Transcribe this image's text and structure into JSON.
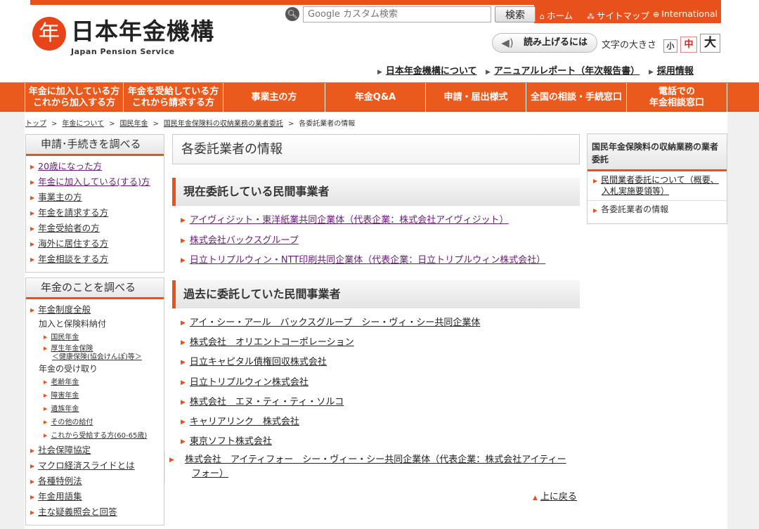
{
  "header": {
    "logo_mark": "年",
    "logo_jp": "日本年金機構",
    "logo_en": "Japan Pension Service",
    "search_placeholder": "Google カスタム検索",
    "search_button": "検索",
    "util_home": "ホーム",
    "util_sitemap": "サイトマップ",
    "util_international": "International",
    "readout_button": "読み上げるには",
    "fontsize_label": "文字の大きさ",
    "fontsize_small": "小",
    "fontsize_mid": "中",
    "fontsize_large": "大",
    "sublinks": [
      "日本年金機構について",
      "アニュアルレポート（年次報告書）",
      "採用情報"
    ]
  },
  "gnav": [
    "年金に加入している方\nこれから加入する方",
    "年金を受給している方\nこれから請求する方",
    "事業主の方",
    "年金Q&A",
    "申請・届出様式",
    "全国の相談・手続窓口",
    "電話での\n年金相談窓口"
  ],
  "breadcrumb": [
    "トップ",
    "年金について",
    "国民年金",
    "国民年金保険料の収納業務の業者委託",
    "各委託業者の情報"
  ],
  "sidebar1": {
    "title": "申請･手続きを調べる",
    "items": [
      "20歳になった方",
      "年金に加入している(する)方",
      "事業主の方",
      "年金を請求する方",
      "年金受給者の方",
      "海外に居住する方",
      "年金相談をする方"
    ]
  },
  "sidebar2": {
    "title": "年金のことを調べる",
    "item1": "年金制度全般",
    "group1": "加入と保険料納付",
    "g1_items": [
      "国民年金",
      "厚生年金保険",
      "＜健康保険(協会けんぽ)等＞"
    ],
    "group2": "年金の受け取り",
    "g2_items": [
      "老齢年金",
      "障害年金",
      "遺族年金",
      "その他の給付",
      "これから受給する方(60-65歳)"
    ],
    "items": [
      "社会保障協定",
      "マクロ経済スライドとは",
      "各種特例法",
      "年金用語集",
      "主な疑義照会と回答"
    ]
  },
  "main": {
    "title": "各委託業者の情報",
    "section1": "現在委託している民間事業者",
    "current": [
      "アイヴィジット・東洋紙業共同企業体（代表企業：株式会社アイヴィジット）",
      "株式会社バックスグループ",
      "日立トリプルウィン・NTT印刷共同企業体（代表企業：日立トリプルウィン株式会社）"
    ],
    "section2": "過去に委託していた民間事業者",
    "past": [
      "アイ・シー・アール　バックスグループ　シー・ヴィ・シー共同企業体",
      "株式会社　オリエントコーポレーション",
      "日立キャピタル債権回収株式会社",
      "日立トリプルウィン株式会社",
      "株式会社　エヌ・ティ・ティ・ソルコ",
      "キャリアリンク　株式会社",
      "東京ソフト株式会社",
      "株式会社　アイティフォー　シー・ヴィー・シー共同企業体（代表企業：株式会社アイティーフォー）"
    ],
    "back_to_top": "上に戻る"
  },
  "right": {
    "title": "国民年金保険料の収納業務の業者委託",
    "items": [
      "民間業者委託について（概要、入札実施要領等）",
      "各委託業者の情報"
    ]
  },
  "colors": {
    "accent": "#e8501c",
    "visited": "#6a1b7a"
  }
}
